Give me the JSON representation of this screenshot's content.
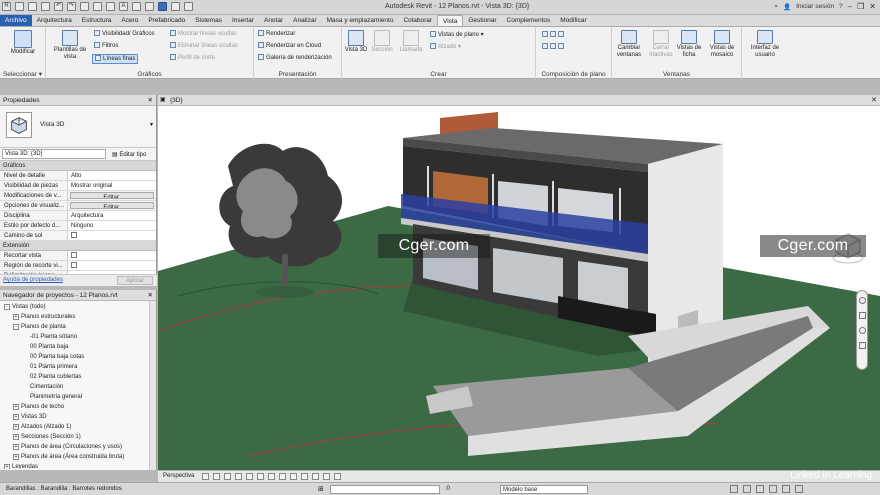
{
  "window": {
    "title": "Autodesk Revit - 12 Planos.rvt - Vista 3D: {3D}",
    "signin": "Iniciar sesión"
  },
  "menu": [
    "Archivo",
    "Arquitectura",
    "Estructura",
    "Acero",
    "Prefabricado",
    "Sistemas",
    "Insertar",
    "Anotar",
    "Analizar",
    "Masa y emplazamiento",
    "Colaborar",
    "Vista",
    "Gestionar",
    "Complementos",
    "Modificar"
  ],
  "ribbon": {
    "modificar": "Modificar",
    "seleccionar": "Seleccionar ▾",
    "plantillas": "Plantillas de vista",
    "graficos": {
      "title": "Gráficos",
      "items": [
        "Visibilidad/ Gráficos",
        "Filtros",
        "Líneas finas"
      ],
      "dim": [
        "Mostrar líneas ocultas",
        "Eliminar líneas ocultas",
        "Perfil de corte"
      ]
    },
    "presentacion": {
      "title": "Presentación",
      "items": [
        "Renderizar",
        "Renderizar en Cloud",
        "Galería de renderización"
      ]
    },
    "crear": {
      "title": "Crear",
      "big": [
        "Vista 3D",
        "Sección",
        "Llamada"
      ],
      "small": [
        "Vistas de plano",
        "Alzado"
      ]
    },
    "composicion": {
      "title": "Composición de plano"
    },
    "ventanas": {
      "title": "Ventanas",
      "big": [
        "Cambiar ventanas",
        "Cerrar inactivas",
        "Vistas de ficha",
        "Vistas de mosaico",
        "Interfaz de usuario"
      ]
    }
  },
  "properties": {
    "title": "Propiedades",
    "type_name": "Vista 3D",
    "selector": "Vista 3D: {3D}",
    "edit_type": "Editar tipo",
    "section_graficos": "Gráficos",
    "rows": [
      {
        "k": "Nivel de detalle",
        "v": "Alto"
      },
      {
        "k": "Visibilidad de piezas",
        "v": "Mostrar original"
      },
      {
        "k": "Modificaciones de v...",
        "v": "Editar..."
      },
      {
        "k": "Opciones de visualiz...",
        "v": "Editar..."
      },
      {
        "k": "Disciplina",
        "v": "Arquitectura"
      },
      {
        "k": "Estilo por defecto d...",
        "v": "Ninguno"
      },
      {
        "k": "Camino de sol",
        "v": ""
      }
    ],
    "section_extension": "Extensión",
    "rows2": [
      {
        "k": "Recortar vista",
        "v": ""
      },
      {
        "k": "Región de recorte vi...",
        "v": ""
      },
      {
        "k": "Delimitación lejana",
        "v": ""
      }
    ],
    "help": "Ayuda de propiedades",
    "apply": "Aplicar"
  },
  "browser": {
    "title": "Navegador de proyectos - 12 Planos.rvt",
    "items": [
      {
        "t": "Vistas (todo)",
        "lv": 0,
        "tg": "-"
      },
      {
        "t": "Planos estructurales",
        "lv": 1,
        "tg": "+"
      },
      {
        "t": "Planos de planta",
        "lv": 1,
        "tg": "-"
      },
      {
        "t": "-01 Planta sótano",
        "lv": 2,
        "tg": ""
      },
      {
        "t": "00 Planta baja",
        "lv": 2,
        "tg": ""
      },
      {
        "t": "00 Planta baja cotas",
        "lv": 2,
        "tg": ""
      },
      {
        "t": "01 Planta primera",
        "lv": 2,
        "tg": ""
      },
      {
        "t": "02 Planta cubiertas",
        "lv": 2,
        "tg": ""
      },
      {
        "t": "Cimentación",
        "lv": 2,
        "tg": ""
      },
      {
        "t": "Planimetría general",
        "lv": 2,
        "tg": ""
      },
      {
        "t": "Planos de techo",
        "lv": 1,
        "tg": "+"
      },
      {
        "t": "Vistas 3D",
        "lv": 1,
        "tg": "+"
      },
      {
        "t": "Alzados (Alzado 1)",
        "lv": 1,
        "tg": "+"
      },
      {
        "t": "Secciones (Sección 1)",
        "lv": 1,
        "tg": "+"
      },
      {
        "t": "Planos de área (Circulaciones y usos)",
        "lv": 1,
        "tg": "+"
      },
      {
        "t": "Planos de área (Área construida bruta)",
        "lv": 1,
        "tg": "+"
      },
      {
        "t": "Leyendas",
        "lv": 0,
        "tg": "+"
      }
    ]
  },
  "viewport": {
    "tab": "{3D}",
    "bottom_label": "Perspectiva"
  },
  "status": {
    "text": "Barandillas : Barandilla : Barrotes redondos",
    "model": "Modelo base",
    "zero": ":0"
  },
  "watermarks": {
    "left": "Cger.com",
    "right": "Cger.com",
    "brand": "Linked in Learning"
  }
}
